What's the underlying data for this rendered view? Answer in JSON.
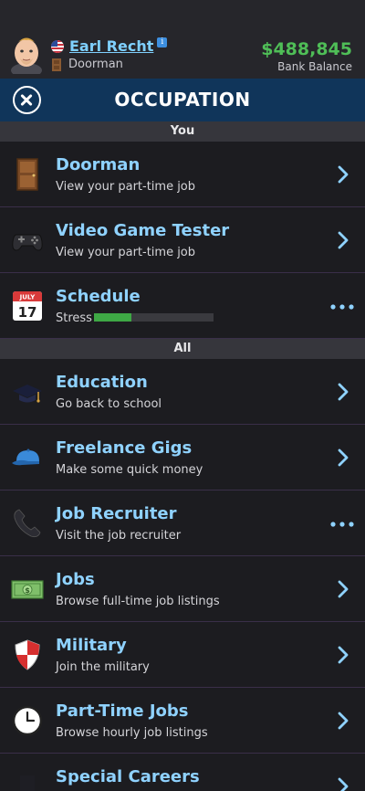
{
  "profile": {
    "name": "Earl Recht",
    "info_badge": "i",
    "job": "Doorman",
    "balance_value": "$488,845",
    "balance_label": "Bank Balance"
  },
  "titlebar": {
    "title": "OCCUPATION"
  },
  "sections": {
    "you": "You",
    "all": "All"
  },
  "rows": [
    {
      "title": "Doorman",
      "subtitle": "View your part-time job",
      "icon": "door-icon",
      "action": "chevron"
    },
    {
      "title": "Video Game Tester",
      "subtitle": "View your part-time job",
      "icon": "gamepad-icon",
      "action": "chevron"
    },
    {
      "title": "Schedule",
      "subtitle": "Stress",
      "icon": "calendar-icon",
      "action": "more",
      "stress_level": 0.31,
      "calendar_month": "JULY",
      "calendar_day": "17"
    },
    {
      "title": "Education",
      "subtitle": "Go back to school",
      "icon": "graduation-cap-icon",
      "action": "chevron"
    },
    {
      "title": "Freelance Gigs",
      "subtitle": "Make some quick money",
      "icon": "cap-icon",
      "action": "chevron"
    },
    {
      "title": "Job Recruiter",
      "subtitle": "Visit the job recruiter",
      "icon": "phone-icon",
      "action": "more"
    },
    {
      "title": "Jobs",
      "subtitle": "Browse full-time job listings",
      "icon": "money-icon",
      "action": "chevron"
    },
    {
      "title": "Military",
      "subtitle": "Join the military",
      "icon": "shield-icon",
      "action": "chevron"
    },
    {
      "title": "Part-Time Jobs",
      "subtitle": "Browse hourly job listings",
      "icon": "clock-icon",
      "action": "chevron"
    },
    {
      "title": "Special Careers",
      "subtitle": "",
      "icon": "top-hat-icon",
      "action": "chevron"
    }
  ],
  "colors": {
    "accent": "#8fd2ff",
    "balance": "#4fbe57",
    "titlebar": "#10355a",
    "stress_fill": "#3ea845"
  }
}
